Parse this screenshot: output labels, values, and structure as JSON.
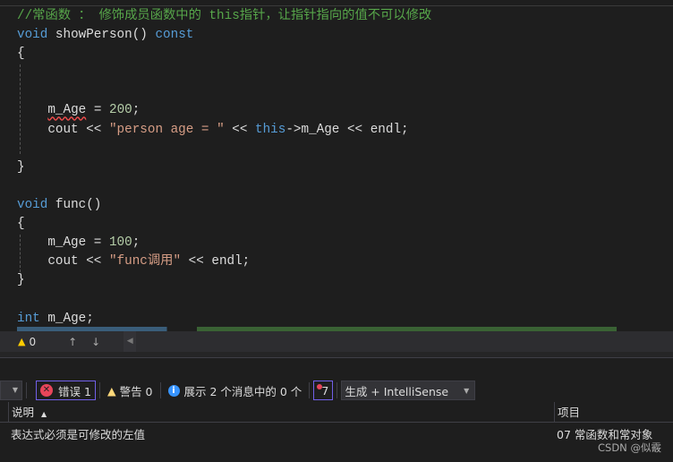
{
  "code_lines": [
    [
      {
        "c": "cm",
        "t": "//常函数 ： 修饰成员函数中的 this指针，让指针指向的值不可以修改"
      }
    ],
    [
      {
        "c": "kw",
        "t": "void"
      },
      {
        "c": "id",
        "t": " showPerson() "
      },
      {
        "c": "kw",
        "t": "const"
      }
    ],
    [
      {
        "c": "id",
        "t": "{"
      }
    ],
    [],
    [],
    [
      {
        "c": "id",
        "t": "    "
      },
      {
        "c": "id squig",
        "t": "m_Age"
      },
      {
        "c": "id",
        "t": " = "
      },
      {
        "c": "num",
        "t": "200"
      },
      {
        "c": "id",
        "t": ";"
      }
    ],
    [
      {
        "c": "id",
        "t": "    cout << "
      },
      {
        "c": "str",
        "t": "\"person age = \""
      },
      {
        "c": "id",
        "t": " << "
      },
      {
        "c": "kw",
        "t": "this"
      },
      {
        "c": "id",
        "t": "->m_Age << endl;"
      }
    ],
    [],
    [
      {
        "c": "id",
        "t": "}"
      }
    ],
    [],
    [
      {
        "c": "kw",
        "t": "void"
      },
      {
        "c": "id",
        "t": " func()"
      }
    ],
    [
      {
        "c": "id",
        "t": "{"
      }
    ],
    [
      {
        "c": "id",
        "t": "    m_Age = "
      },
      {
        "c": "num",
        "t": "100"
      },
      {
        "c": "id",
        "t": ";"
      }
    ],
    [
      {
        "c": "id",
        "t": "    cout << "
      },
      {
        "c": "str",
        "t": "\"func调用\""
      },
      {
        "c": "id",
        "t": " << endl;"
      }
    ],
    [
      {
        "c": "id",
        "t": "}"
      }
    ],
    [],
    [
      {
        "c": "kw",
        "t": "int"
      },
      {
        "c": "id",
        "t": " m_Age;"
      }
    ]
  ],
  "status": {
    "warnings": "0",
    "up_icon": "arrow-up",
    "down_icon": "arrow-down"
  },
  "toolbar": {
    "errors_label": "错误 1",
    "warnings_label": "警告 0",
    "messages_label": "展示 2 个消息中的 0 个",
    "filter_count": "7",
    "build_filter": "生成 + IntelliSense"
  },
  "table": {
    "headers": [
      "说明",
      "项目"
    ],
    "rows": [
      [
        "表达式必须是可修改的左值",
        "07 常函数和常对象"
      ]
    ]
  },
  "watermark": "CSDN @似霰",
  "colors": {
    "error": "#e51400",
    "warning": "#ffcc00",
    "info": "#3794ff",
    "highlight": "#7160e8"
  }
}
